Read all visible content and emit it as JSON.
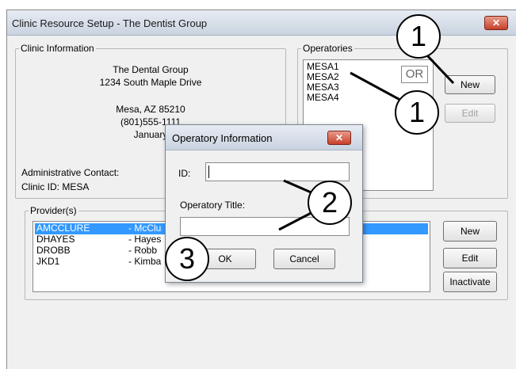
{
  "window": {
    "title": "Clinic Resource Setup  - The Dentist Group",
    "close_glyph": "✕"
  },
  "clinic_info": {
    "legend": "Clinic Information",
    "name": "The Dental Group",
    "address": "1234 South Maple Drive",
    "city": "Mesa, AZ 85210",
    "phone": "(801)555-1111",
    "month": "January",
    "admin_contact_label": "Administrative Contact:",
    "clinic_id_text": "Clinic ID:  MESA"
  },
  "operatories": {
    "legend": "Operatories",
    "items": [
      "MESA1",
      "MESA2",
      "MESA3",
      "MESA4"
    ],
    "new_label": "New",
    "edit_label": "Edit"
  },
  "providers": {
    "legend": "Provider(s)",
    "rows": [
      {
        "code": "AMCCLURE",
        "name": "- McClu"
      },
      {
        "code": "DHAYES",
        "name": "- Hayes"
      },
      {
        "code": "DROBB",
        "name": "- Robb"
      },
      {
        "code": "JKD1",
        "name": "- Kimba"
      }
    ],
    "new_label": "New",
    "edit_label": "Edit",
    "inactivate_label": "Inactivate"
  },
  "dialog": {
    "title": "Operatory Information",
    "close_glyph": "✕",
    "id_label": "ID:",
    "id_value": "",
    "op_title_label": "Operatory Title:",
    "op_title_value": "",
    "ok_label": "OK",
    "cancel_label": "Cancel"
  },
  "callouts": {
    "c1": "1",
    "c2": "1",
    "c3": "2",
    "c4": "3",
    "or_text": "OR"
  },
  "colors": {
    "selection": "#3399ff"
  }
}
